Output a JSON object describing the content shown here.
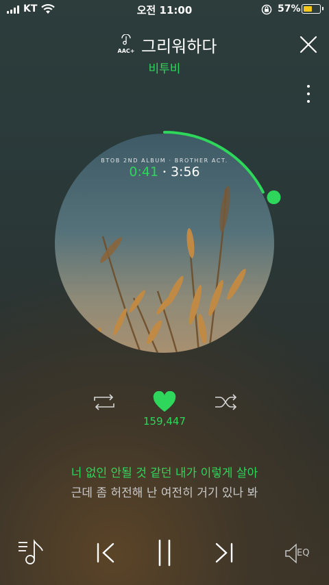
{
  "status_bar": {
    "carrier": "KT",
    "time": "오전 11:00",
    "battery_percent": "57%",
    "battery_level": 0.57,
    "battery_color": "#f5c518"
  },
  "header": {
    "quality_badge": "AAC+",
    "title": "그리워하다",
    "artist": "비투비"
  },
  "album": {
    "caption": "BTOB 2ND ALBUM · BROTHER ACT.",
    "elapsed": "0:41",
    "separator": "•",
    "total": "3:56",
    "progress": 0.174
  },
  "actions": {
    "like_count": "159,447",
    "repeat_icon": "repeat-icon",
    "like_icon": "heart-icon",
    "shuffle_icon": "shuffle-icon"
  },
  "lyrics": {
    "current": "너 없인 안될 것 같던 내가 이렇게 살아",
    "next": "근데 좀 허전해 난 여전히 거기 있나 봐"
  },
  "controls": {
    "eq_label": "EQ",
    "icons": [
      "playlist-icon",
      "previous-icon",
      "pause-icon",
      "next-icon",
      "eq-speaker-icon"
    ]
  },
  "colors": {
    "accent": "#2fd65c",
    "background": "#2b3432"
  }
}
